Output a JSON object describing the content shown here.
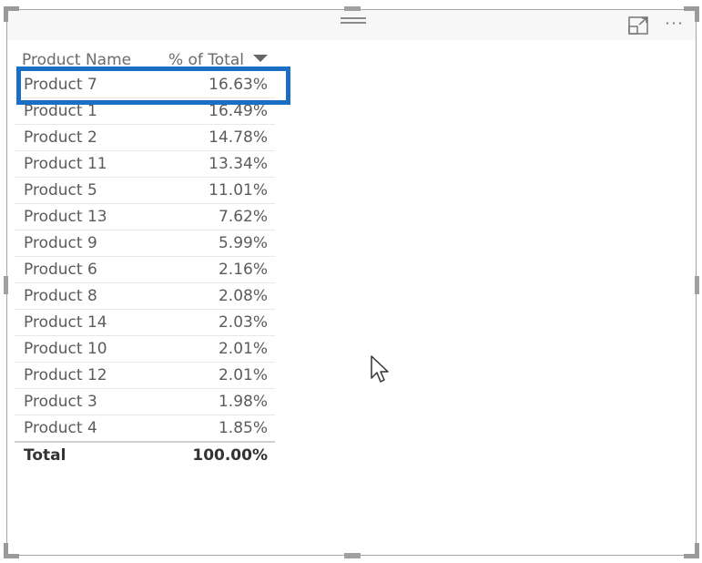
{
  "visual": {
    "type": "table",
    "header_actions": {
      "drag_handle": "drag-grip-icon",
      "focus_mode": "focus-mode-icon",
      "more_options": "more-options-icon",
      "more_options_glyph": "···"
    },
    "columns": [
      "Product Name",
      "% of Total"
    ],
    "sort": {
      "column": "% of Total",
      "direction": "descending"
    },
    "rows": [
      {
        "name": "Product 7",
        "value": "16.63%",
        "highlighted": true
      },
      {
        "name": "Product 1",
        "value": "16.49%"
      },
      {
        "name": "Product 2",
        "value": "14.78%"
      },
      {
        "name": "Product 11",
        "value": "13.34%"
      },
      {
        "name": "Product 5",
        "value": "11.01%"
      },
      {
        "name": "Product 13",
        "value": "7.62%"
      },
      {
        "name": "Product 9",
        "value": "5.99%"
      },
      {
        "name": "Product 6",
        "value": "2.16%"
      },
      {
        "name": "Product 8",
        "value": "2.08%"
      },
      {
        "name": "Product 14",
        "value": "2.03%"
      },
      {
        "name": "Product 10",
        "value": "2.01%"
      },
      {
        "name": "Product 12",
        "value": "2.01%"
      },
      {
        "name": "Product 3",
        "value": "1.98%"
      },
      {
        "name": "Product 4",
        "value": "1.85%"
      }
    ],
    "total": {
      "label": "Total",
      "value": "100.00%"
    },
    "highlight_color": "#1a6fc4"
  }
}
